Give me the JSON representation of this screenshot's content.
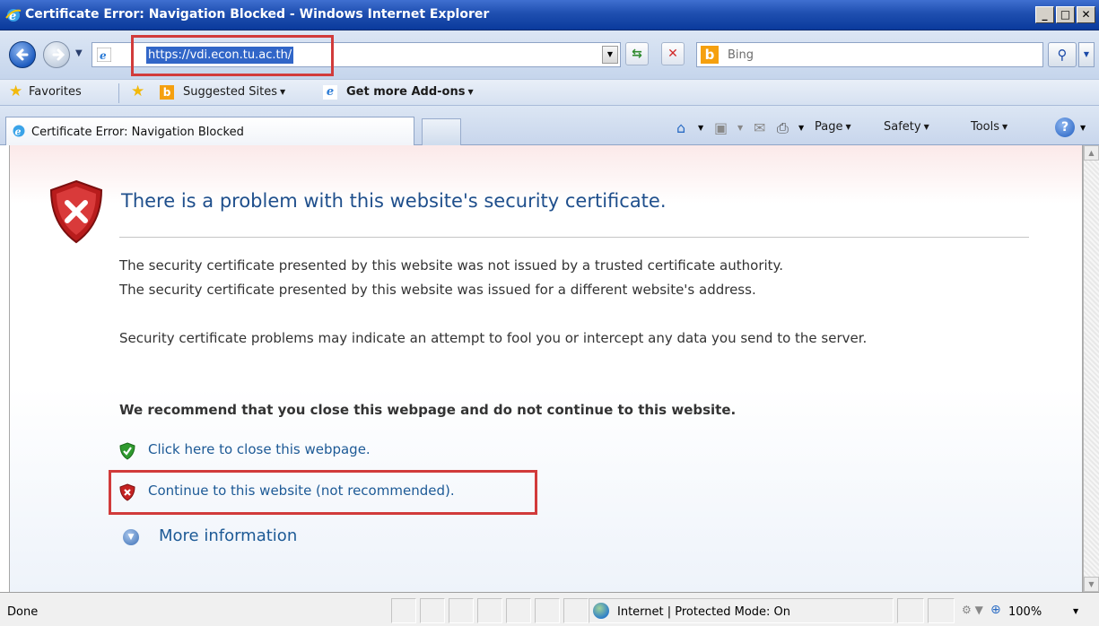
{
  "window": {
    "title": "Certificate Error: Navigation Blocked - Windows Internet Explorer",
    "buttons": {
      "minimize": "_",
      "maximize": "□",
      "close": "✕"
    }
  },
  "address_bar": {
    "url": "https://vdi.econ.tu.ac.th/",
    "dropdown": "▼"
  },
  "search": {
    "placeholder": "Bing",
    "logo": "b",
    "go_icon": "⚲",
    "dropdown": "▼"
  },
  "favorites_bar": {
    "favorites_label": "Favorites",
    "suggested_sites": "Suggested Sites",
    "add_ons": "Get more Add-ons"
  },
  "tab": {
    "label": "Certificate Error: Navigation Blocked"
  },
  "command_bar": {
    "page": "Page",
    "safety": "Safety",
    "tools": "Tools"
  },
  "content": {
    "headline": "There is a problem with this website's security certificate.",
    "para1_line1": "The security certificate presented by this website was not issued by a trusted certificate authority.",
    "para1_line2": "The security certificate presented by this website was issued for a different website's address.",
    "para2": "Security certificate problems may indicate an attempt to fool you or intercept any data you send to the server.",
    "recommendation": "We recommend that you close this webpage and do not continue to this website.",
    "close_link": "Click here to close this webpage.",
    "continue_link": "Continue to this website (not recommended).",
    "more_info": "More information"
  },
  "status_bar": {
    "status": "Done",
    "zone": "Internet | Protected Mode: On",
    "zoom": "100%"
  },
  "colors": {
    "highlight": "#d13b3b",
    "link": "#1d5a96",
    "headline": "#1f4f8c",
    "titlebar": "#1f4fb0"
  },
  "icons": [
    "ie-logo-icon",
    "back-arrow-icon",
    "forward-arrow-icon",
    "refresh-icon",
    "stop-icon",
    "bing-icon",
    "search-icon",
    "favorites-star-icon",
    "add-favorites-icon",
    "home-icon",
    "feeds-icon",
    "mail-icon",
    "print-icon",
    "help-icon",
    "shield-error-icon",
    "shield-ok-icon",
    "expand-circle-icon",
    "globe-icon",
    "zoom-icon"
  ]
}
